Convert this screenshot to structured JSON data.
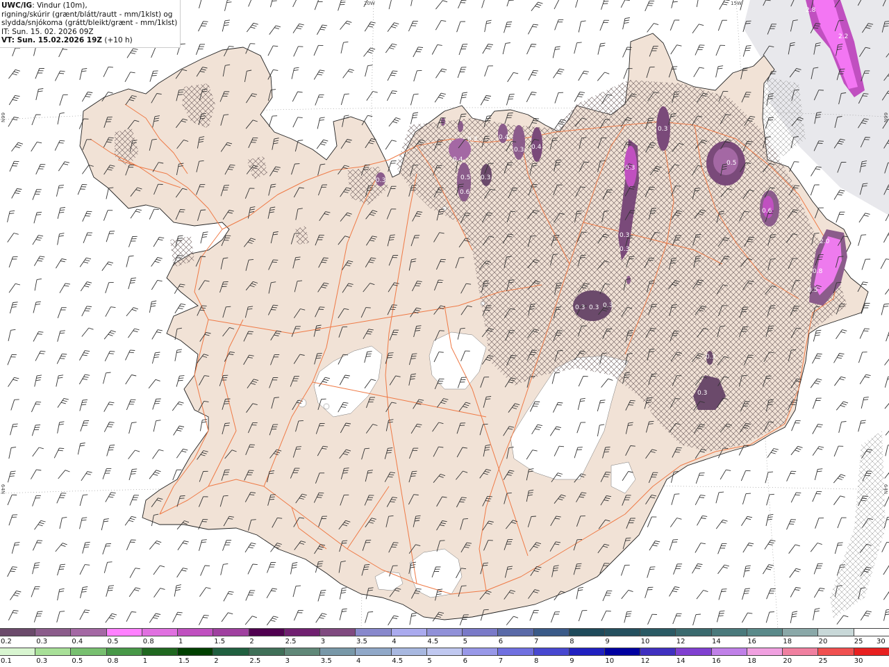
{
  "header": {
    "title": "UWC/IG",
    "line1_rest": ": Vindur (10m),",
    "line2": "rigning/skúrir (grænt/blátt/rautt - mm/1klst) og",
    "line3": "slydda/snjókoma (grátt/bleikt/grænt - mm/1klst)",
    "issue_time": "IT: Sun. 15. 02. 2026 09Z",
    "valid_time": "VT: Sun. 15.02.2026 19Z",
    "lead": " (+10 h)"
  },
  "graticule": {
    "lon_20w": "20W",
    "lon_15w": "15W",
    "lat_66n_left": "66N",
    "lat_66n_right": "66N",
    "lat_64n_left": "64N",
    "lat_64n_right": "64N"
  },
  "precip_labels": [
    "2.8",
    "2.2",
    "0.3",
    "0.5",
    "0.6",
    "2.0",
    "0.8",
    "0.5",
    "0.3",
    "0.3",
    "0.3",
    "0.3",
    "0.3",
    "0.3",
    "0.3",
    "0.3",
    "0.4",
    "0.5",
    "0.6",
    "0.3",
    "0.4",
    "0.3",
    "0.4",
    "0.3",
    "0.3"
  ],
  "colorbar_snow": {
    "colors": [
      "#6b4a6b",
      "#8b5c8b",
      "#a468a4",
      "#ff80ff",
      "#e070e0",
      "#c050c0",
      "#a040a0",
      "#500050",
      "#702070",
      "#804a80",
      "#8888cc",
      "#aaaaee",
      "#9090d8",
      "#7a7ac8",
      "#5a6aa8",
      "#3a5a88",
      "#1e4a5a",
      "#24505e",
      "#2a5a64",
      "#3a6a6e",
      "#4a7a7c",
      "#5a8a8a",
      "#8aa8a8",
      "#c8d8d8",
      "#ffffff"
    ],
    "labels": [
      "0.2",
      "0.3",
      "0.4",
      "0.5",
      "0.8",
      "1",
      "1.5",
      "2",
      "2.5",
      "3",
      "3.5",
      "4",
      "4.5",
      "5",
      "6",
      "7",
      "8",
      "9",
      "10",
      "12",
      "14",
      "16",
      "18",
      "20",
      "25",
      "30"
    ]
  },
  "colorbar_rain": {
    "colors": [
      "#d8f5d0",
      "#a8e098",
      "#78c070",
      "#489848",
      "#206820",
      "#004000",
      "#206040",
      "#407058",
      "#608878",
      "#7898a8",
      "#90a8c8",
      "#a8b8e0",
      "#c0c8f0",
      "#9898e8",
      "#7070e0",
      "#4848d0",
      "#2020c0",
      "#0000a0",
      "#4030c0",
      "#8040d0",
      "#c080e8",
      "#f0a0e0",
      "#f080a0",
      "#f05050",
      "#e82020"
    ],
    "labels": [
      "0.1",
      "0.3",
      "0.5",
      "0.8",
      "1",
      "1.5",
      "2",
      "2.5",
      "3",
      "3.5",
      "4",
      "4.5",
      "5",
      "6",
      "7",
      "8",
      "9",
      "10",
      "12",
      "14",
      "16",
      "18",
      "20",
      "25",
      "30"
    ]
  }
}
